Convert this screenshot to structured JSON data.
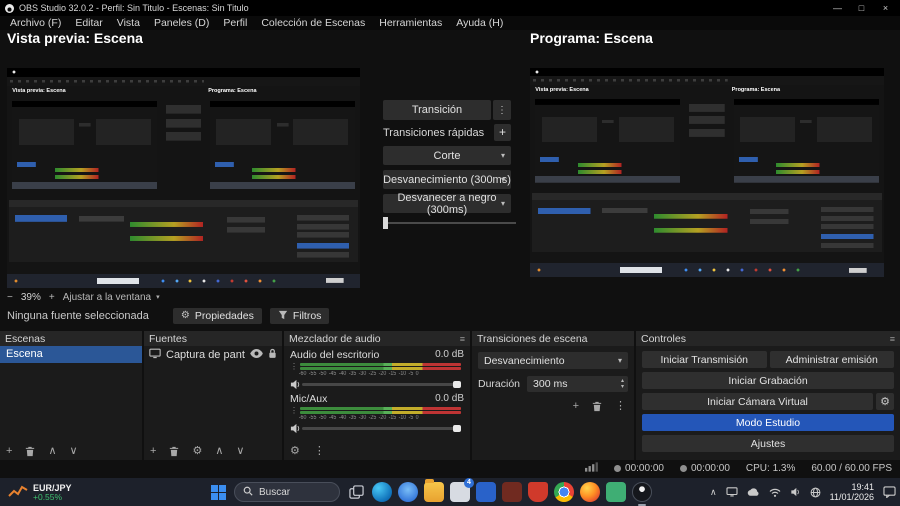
{
  "window": {
    "title": "OBS Studio 32.0.2 - Perfil: Sin Titulo - Escenas: Sin Titulo"
  },
  "menu": {
    "items": [
      "Archivo (F)",
      "Editar",
      "Vista",
      "Paneles (D)",
      "Perfil",
      "Colección de Escenas",
      "Herramientas",
      "Ayuda (H)"
    ]
  },
  "studio": {
    "preview_label": "Vista previa: Escena",
    "program_label": "Programa: Escena",
    "zoom": {
      "value": "39%",
      "fit_label": "Ajustar a la ventana"
    },
    "transitions_panel": {
      "transition_button": "Transición",
      "quick_label": "Transiciones rápidas",
      "quick_items": [
        "Corte",
        "Desvanecimiento (300ms)",
        "Desvanecer a negro (300ms)"
      ]
    }
  },
  "source_bar": {
    "no_source": "Ninguna fuente seleccionada",
    "properties": "Propiedades",
    "filters": "Filtros"
  },
  "docks": {
    "scenes": {
      "title": "Escenas",
      "items": [
        {
          "label": "Escena"
        }
      ]
    },
    "sources": {
      "title": "Fuentes",
      "items": [
        {
          "label": "Captura de pantalla"
        }
      ]
    },
    "mixer": {
      "title": "Mezclador de audio",
      "channels": [
        {
          "name": "Audio del escritorio",
          "level": "0.0 dB",
          "scale": "-60 -55 -50 -45 -40 -35 -30 -25 -20 -15 -10 -5 0"
        },
        {
          "name": "Mic/Aux",
          "level": "0.0 dB",
          "scale": "-60 -55 -50 -45 -40 -35 -30 -25 -20 -15 -10 -5 0"
        }
      ]
    },
    "transitions": {
      "title": "Transiciones de escena",
      "current": "Desvanecimiento",
      "duration_label": "Duración",
      "duration_value": "300 ms"
    },
    "controls": {
      "title": "Controles",
      "stream": "Iniciar Transmisión",
      "manage": "Administrar emisión",
      "record": "Iniciar Grabación",
      "virtual_cam": "Iniciar Cámara Virtual",
      "studio_mode": "Modo Estudio",
      "settings": "Ajustes"
    }
  },
  "status_bar": {
    "stream_time": "00:00:00",
    "record_time": "00:00:00",
    "cpu": "CPU: 1.3%",
    "fps": "60.00 / 60.00 FPS"
  },
  "taskbar": {
    "widget": {
      "symbol": "EUR/JPY",
      "change": "+0.55%"
    },
    "search_placeholder": "Buscar",
    "badge": "4",
    "time": "19:41",
    "date": "11/01/2026"
  },
  "icons": {
    "minimize": "—",
    "maximize": "□",
    "close": "×",
    "plus": "+",
    "minus": "−",
    "gear": "⚙",
    "dots_vertical": "⋮",
    "menu_lines": "≡",
    "chevron_down": "▾",
    "chevron_up": "▴",
    "arrow_up": "∧",
    "arrow_down": "∨",
    "tray_chevron": "∧"
  },
  "colors": {
    "accent_blue": "#2456b8",
    "selection_blue": "#2b5797",
    "positive_green": "#3fbf6f",
    "meter_green": "#3c8c3c",
    "meter_yellow": "#c3ad2b",
    "meter_red": "#bf3434"
  }
}
